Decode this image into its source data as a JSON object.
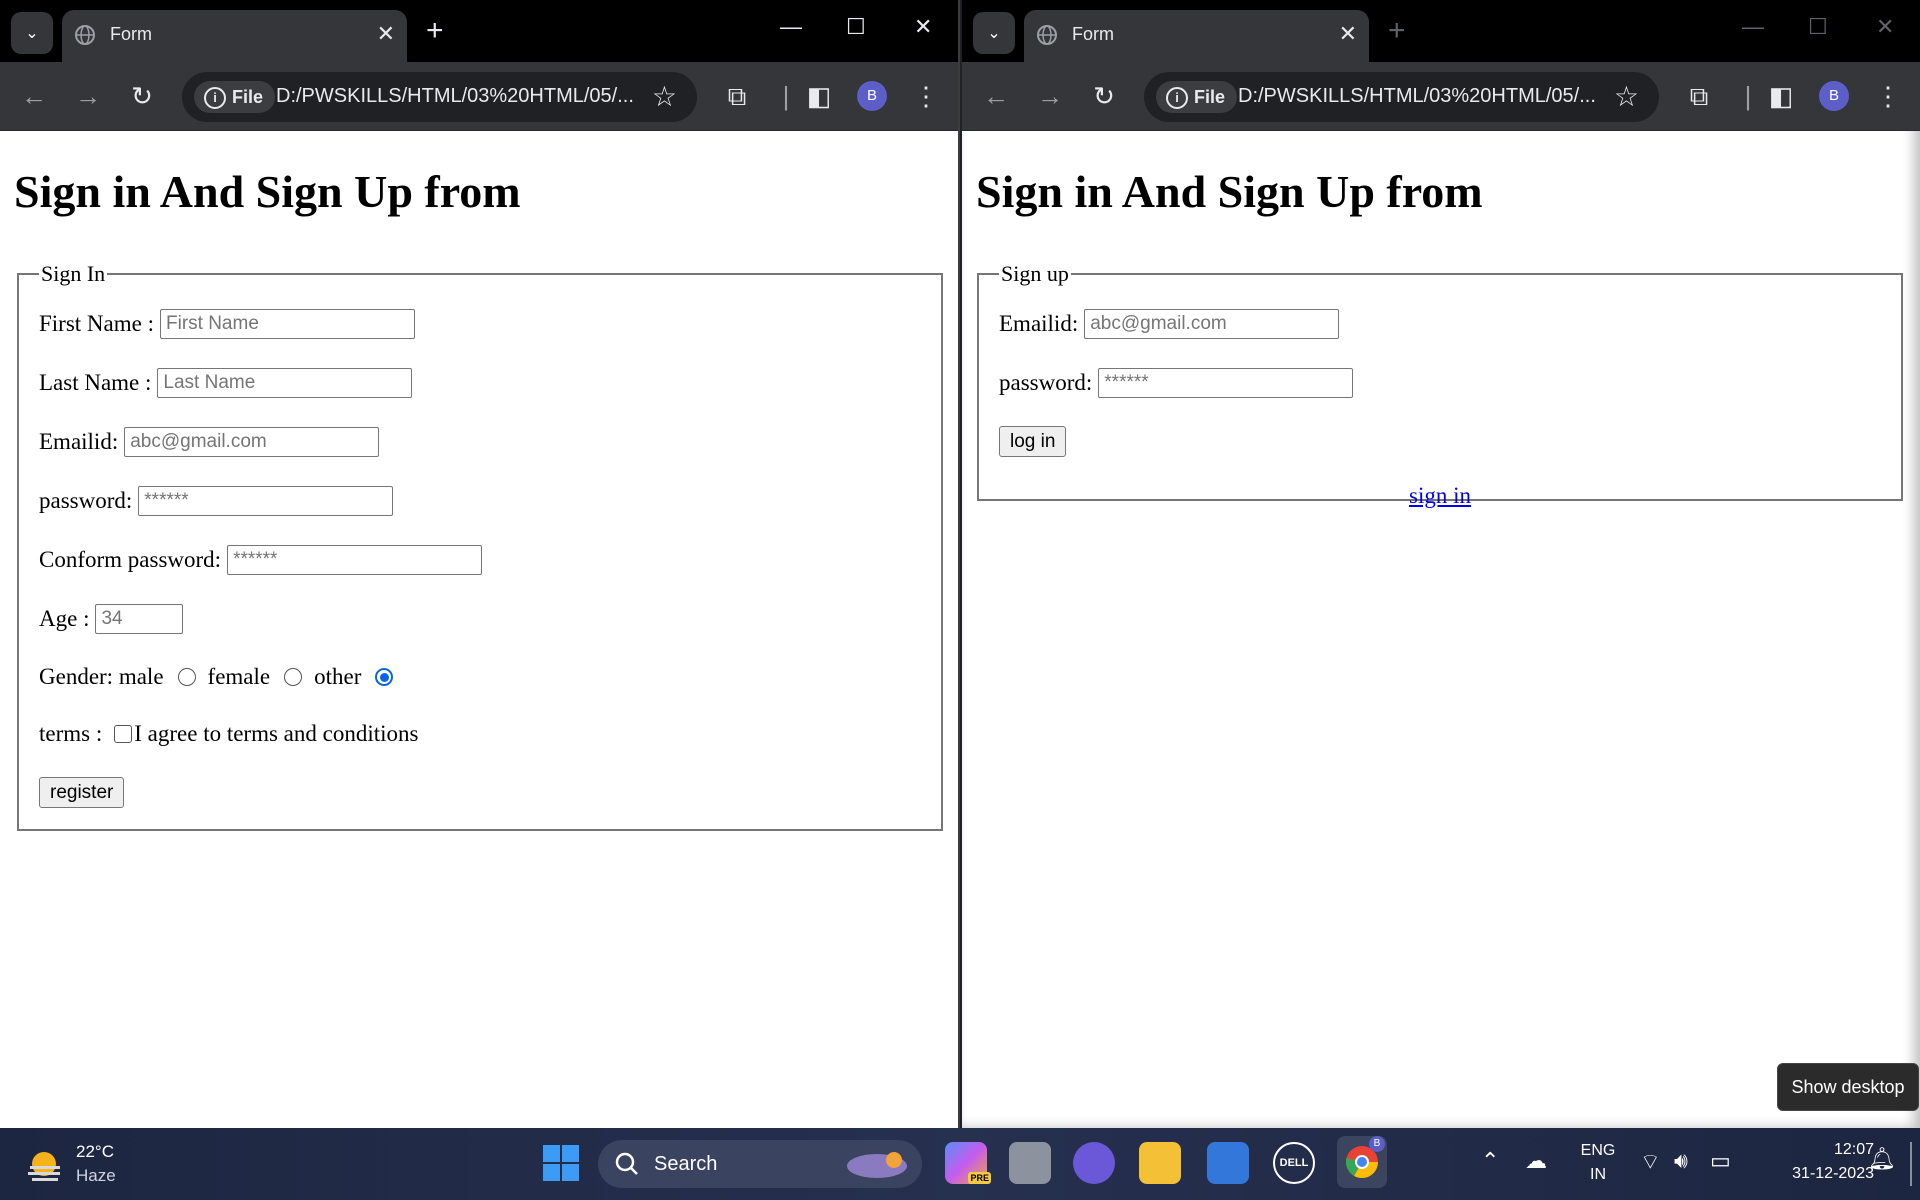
{
  "windows": [
    {
      "id": "left",
      "tab_title": "Form",
      "url_chip": "File",
      "url": "D:/PWSKILLS/HTML/03%20HTML/05/...",
      "avatar_letter": "B",
      "page": {
        "heading": "Sign in And Sign Up from",
        "legend": "Sign In",
        "fields": {
          "first_name_label": "First Name :",
          "first_name_placeholder": "First Name",
          "last_name_label": "Last Name :",
          "last_name_placeholder": "Last Name",
          "email_label": "Emailid:",
          "email_placeholder": "abc@gmail.com",
          "password_label": "password:",
          "password_placeholder": "******",
          "confirm_label": "Conform password:",
          "confirm_placeholder": "******",
          "age_label": "Age :",
          "age_placeholder": "34",
          "gender_label": "Gender: male",
          "female_label": "female",
          "other_label": "other",
          "gender_selected": "other",
          "terms_label": "terms :",
          "terms_text": "I agree to terms and conditions",
          "register_button": "register"
        }
      }
    },
    {
      "id": "right",
      "tab_title": "Form",
      "url_chip": "File",
      "url": "D:/PWSKILLS/HTML/03%20HTML/05/...",
      "avatar_letter": "B",
      "page": {
        "heading": "Sign in And Sign Up from",
        "legend": "Sign up",
        "fields": {
          "email_label": "Emailid:",
          "email_placeholder": "abc@gmail.com",
          "password_label": "password:",
          "password_placeholder": "******",
          "login_button": "log in",
          "signin_link": "sign in"
        }
      }
    }
  ],
  "taskbar": {
    "weather_temp": "22°C",
    "weather_desc": "Haze",
    "search_label": "Search",
    "lang_top": "ENG",
    "lang_bottom": "IN",
    "time": "12:07",
    "date": "31-12-2023",
    "show_desktop_tooltip": "Show desktop",
    "chrome_badge": "B",
    "copilot_badge": "PRE",
    "dell_logo": "DELL"
  },
  "colors": {
    "chrome_dark": "#35363a",
    "accent_radio": "#0b63e5",
    "link": "#0000ee"
  }
}
